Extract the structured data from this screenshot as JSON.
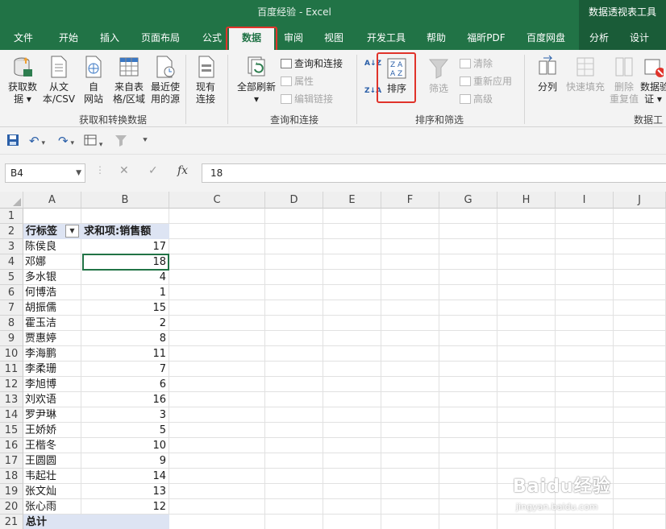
{
  "title": "百度经验  -  Excel",
  "context_tab_title": "数据透视表工具",
  "tabs": [
    "文件",
    "开始",
    "插入",
    "页面布局",
    "公式",
    "数据",
    "审阅",
    "视图",
    "开发工具",
    "帮助",
    "福昕PDF",
    "百度网盘",
    "分析",
    "设计"
  ],
  "active_tab": "数据",
  "ribbon": {
    "get_data": [
      "获取数",
      "据"
    ],
    "from_text": [
      "从文",
      "本/CSV"
    ],
    "from_web": [
      "自",
      "网站"
    ],
    "from_table": [
      "来自表",
      "格/区域"
    ],
    "recent_sources": [
      "最近使",
      "用的源"
    ],
    "existing_conn": [
      "现有",
      "连接"
    ],
    "group_get_transform": "获取和转换数据",
    "refresh_all": "全部刷新",
    "queries_conn": "查询和连接",
    "properties": "属性",
    "edit_links": "编辑链接",
    "group_queries": "查询和连接",
    "sort_az": "A↓Z",
    "sort_za": "Z↓A",
    "sort": "排序",
    "filter": "筛选",
    "clear": "清除",
    "reapply": "重新应用",
    "advanced": "高级",
    "group_sort_filter": "排序和筛选",
    "text_to_columns": "分列",
    "flash_fill": "快速填充",
    "remove_dup": [
      "删除",
      "重复值"
    ],
    "data_validation": [
      "数据验",
      "证"
    ],
    "group_data_tools": "数据工"
  },
  "namebox": "B4",
  "formula_value": "18",
  "fx_label": "fx",
  "columns": [
    "A",
    "B",
    "C",
    "D",
    "E",
    "F",
    "G",
    "H",
    "I",
    "J"
  ],
  "rows": [
    "1",
    "2",
    "3",
    "4",
    "5",
    "6",
    "7",
    "8",
    "9",
    "10",
    "11",
    "12",
    "13",
    "14",
    "15",
    "16",
    "17",
    "18",
    "19",
    "20",
    "21"
  ],
  "pivot": {
    "row_label_header": "行标签",
    "value_header": "求和项:销售额",
    "names": [
      "陈侯良",
      "邓娜",
      "多水银",
      "何博浩",
      "胡振儒",
      "霍玉洁",
      "贾惠婷",
      "李海鹏",
      "李柔珊",
      "李旭博",
      "刘欢语",
      "罗尹琳",
      "王娇娇",
      "王楷冬",
      "王圆圆",
      "韦起壮",
      "张文灿",
      "张心雨"
    ],
    "values": [
      "17",
      "18",
      "4",
      "1",
      "15",
      "2",
      "8",
      "11",
      "7",
      "6",
      "16",
      "3",
      "5",
      "10",
      "9",
      "14",
      "13",
      "12"
    ],
    "total_label": "总计"
  },
  "watermark": "Baidu经验",
  "watermark_url": "jingyan.baidu.com",
  "colors": {
    "excel_green": "#217346",
    "highlight": "#e0332a",
    "pivot_header": "#dde4f3"
  }
}
